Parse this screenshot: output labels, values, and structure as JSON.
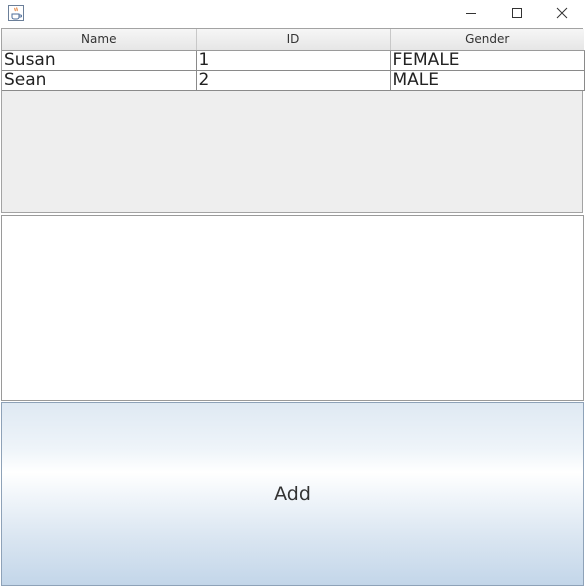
{
  "window": {
    "icon": "java-cup-icon",
    "controls": {
      "minimize_icon": "minimize-icon",
      "maximize_icon": "maximize-icon",
      "close_icon": "close-icon"
    }
  },
  "table": {
    "columns": [
      "Name",
      "ID",
      "Gender"
    ],
    "rows": [
      [
        "Susan",
        "1",
        "FEMALE"
      ],
      [
        "Sean",
        "2",
        "MALE"
      ]
    ]
  },
  "text_area": {
    "value": ""
  },
  "add_button": {
    "label": "Add"
  }
}
